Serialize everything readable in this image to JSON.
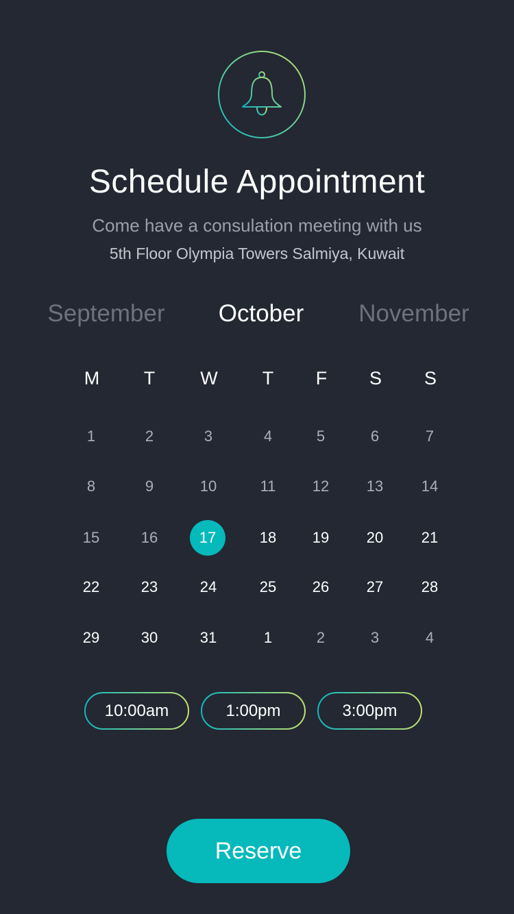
{
  "header": {
    "icon": "bell-icon",
    "title": "Schedule Appointment",
    "subtitle": "Come have a consulation meeting with us",
    "address": "5th Floor Olympia Towers Salmiya, Kuwait"
  },
  "months": {
    "prev": "September",
    "current": "October",
    "next": "November"
  },
  "calendar": {
    "weekdays": [
      "M",
      "T",
      "W",
      "T",
      "F",
      "S",
      "S"
    ],
    "selected_day": "17",
    "weeks": [
      [
        "1",
        "2",
        "3",
        "4",
        "5",
        "6",
        "7"
      ],
      [
        "8",
        "9",
        "10",
        "11",
        "12",
        "13",
        "14"
      ],
      [
        "15",
        "16",
        "17",
        "18",
        "19",
        "20",
        "21"
      ],
      [
        "22",
        "23",
        "24",
        "25",
        "26",
        "27",
        "28"
      ],
      [
        "29",
        "30",
        "31",
        "1",
        "2",
        "3",
        "4"
      ]
    ]
  },
  "time_slots": [
    "10:00am",
    "1:00pm",
    "3:00pm"
  ],
  "reserve_label": "Reserve",
  "colors": {
    "background": "#232833",
    "accent": "#06b9bb",
    "gradient_start": "#12b8bf",
    "gradient_end": "#c0e06d"
  }
}
